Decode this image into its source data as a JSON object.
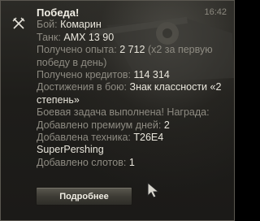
{
  "notification": {
    "time": "16:42",
    "title": "Победа!",
    "battle_label": "Бой:",
    "battle_value": "Комарин",
    "tank_label": "Танк:",
    "tank_value": "AMX 13 90",
    "xp_label": "Получено опыта:",
    "xp_value": "2 712",
    "xp_note": "(x2 за первую победу в день)",
    "credits_label": "Получено кредитов:",
    "credits_value": "114 314",
    "achievements_label": "Достижения в бою:",
    "achievements_value": "Знак классности «2 степень»",
    "task_line": "Боевая задача выполнена! Награда:",
    "premium_label": "Добавлено премиум дней:",
    "premium_value": "2",
    "vehicle_label": "Добавлена техника:",
    "vehicle_value_1": "T26E4",
    "vehicle_value_2": "SuperPershing",
    "slots_label": "Добавлено слотов:",
    "slots_value": "1",
    "details_button": "Подробнее"
  },
  "icons": {
    "type_icon": "crossed-swords-icon",
    "cursor": "mouse-pointer-icon"
  }
}
